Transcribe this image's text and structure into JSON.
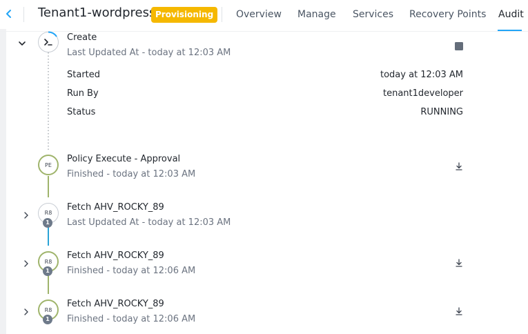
{
  "header": {
    "back_icon": "chevron-left-icon",
    "app_name": "Tenant1-wordpress",
    "status_badge": "Provisioning",
    "tabs": [
      {
        "label": "Overview"
      },
      {
        "label": "Manage"
      },
      {
        "label": "Services"
      },
      {
        "label": "Recovery Points"
      },
      {
        "label": "Audit",
        "active": true
      }
    ]
  },
  "colors": {
    "accent": "#22a5f7",
    "badge": "#f5b800",
    "node_green": "#9fb46b",
    "connector_blue": "#2aa3d6"
  },
  "timeline": {
    "create": {
      "title": "Create",
      "subtitle": "Last Updated At - today at 12:03 AM",
      "icon": "terminal-icon",
      "stop_icon": "stop-square-icon",
      "details": [
        {
          "key": "Started",
          "value": "today at 12:03 AM"
        },
        {
          "key": "Run By",
          "value": "tenant1developer"
        },
        {
          "key": "Status",
          "value": "RUNNING"
        }
      ]
    },
    "steps": [
      {
        "node": "PE",
        "title": "Policy Execute - Approval",
        "subtitle": "Finished - today at 12:03 AM",
        "download": true
      },
      {
        "node": "R8",
        "count": "1",
        "title": "Fetch AHV_ROCKY_89",
        "subtitle": "Last Updated At - today at 12:03 AM",
        "download": false
      },
      {
        "node": "R8",
        "count": "1",
        "title": "Fetch AHV_ROCKY_89",
        "subtitle": "Finished - today at 12:06 AM",
        "download": true
      },
      {
        "node": "R8",
        "count": "1",
        "title": "Fetch AHV_ROCKY_89",
        "subtitle": "Finished - today at 12:06 AM",
        "download": true
      }
    ]
  }
}
